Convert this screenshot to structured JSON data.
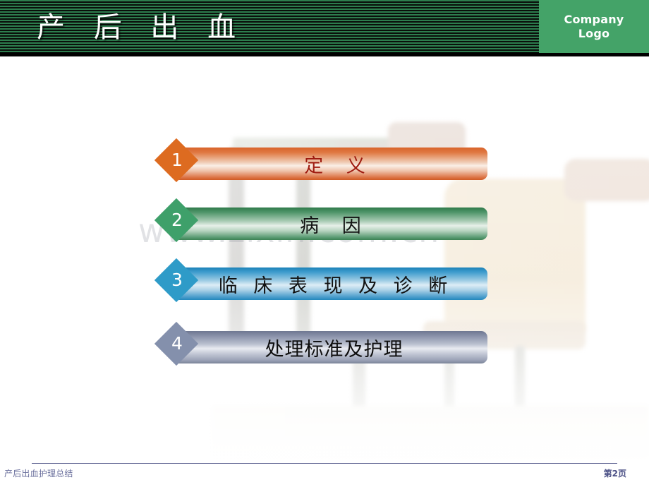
{
  "header": {
    "title": "产 后 出 血",
    "logo_line1": "Company",
    "logo_line2": "Logo",
    "stripe_green": "#2d7d4e",
    "stripe_black": "#0a0f0b",
    "logo_bg": "#44a368"
  },
  "watermark": {
    "text": "www.zixin.com.cn"
  },
  "agenda": {
    "items": [
      {
        "number": "1",
        "label": "定  义",
        "diamond_color": "#dd6b20",
        "text_color": "#9e1b10"
      },
      {
        "number": "2",
        "label": "病  因",
        "diamond_color": "#3ea06a",
        "text_color": "#121212"
      },
      {
        "number": "3",
        "label": "临 床 表 现 及 诊 断",
        "diamond_color": "#2e9bc8",
        "text_color": "#111111"
      },
      {
        "number": "4",
        "label": "处理标准及护理",
        "diamond_color": "#8490ac",
        "text_color": "#0d0d0d"
      }
    ]
  },
  "footer": {
    "left_text": "产后出血护理总结",
    "page_label": "第2页"
  }
}
